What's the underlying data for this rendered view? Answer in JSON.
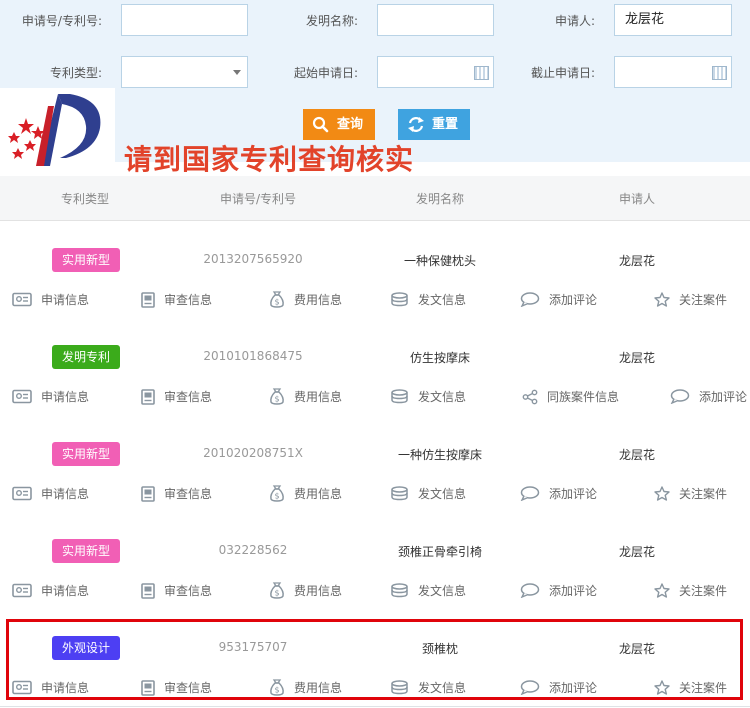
{
  "search": {
    "labels": {
      "app_no": "申请号/专利号:",
      "invention_name": "发明名称:",
      "applicant": "申请人:",
      "patent_type": "专利类型:",
      "start_date": "起始申请日:",
      "end_date": "截止申请日:"
    },
    "values": {
      "app_no": "",
      "invention_name": "",
      "applicant": "龙层花",
      "patent_type": "",
      "start_date": "",
      "end_date": ""
    },
    "buttons": {
      "query": "查询",
      "reset": "重置"
    }
  },
  "overlay_text": "请到国家专利查询核实",
  "table": {
    "headers": [
      "专利类型",
      "申请号/专利号",
      "发明名称",
      "申请人"
    ],
    "rows": [
      {
        "type": "实用新型",
        "type_color": "#f15fb5",
        "number": "2013207565920",
        "title": "一种保健枕头",
        "applicant": "龙层花",
        "actions": [
          "申请信息",
          "审查信息",
          "费用信息",
          "发文信息",
          "添加评论",
          "关注案件"
        ],
        "icons": [
          "id-card-icon",
          "document-icon",
          "money-bag-icon",
          "coins-stack-icon",
          "comment-icon",
          "star-icon"
        ]
      },
      {
        "type": "发明专利",
        "type_color": "#3bab1b",
        "number": "2010101868475",
        "title": "仿生按摩床",
        "applicant": "龙层花",
        "actions": [
          "申请信息",
          "审查信息",
          "费用信息",
          "发文信息",
          "同族案件信息",
          "添加评论"
        ],
        "icons": [
          "id-card-icon",
          "document-icon",
          "money-bag-icon",
          "coins-stack-icon",
          "share-icon",
          "comment-icon"
        ]
      },
      {
        "type": "实用新型",
        "type_color": "#f15fb5",
        "number": "201020208751X",
        "title": "一种仿生按摩床",
        "applicant": "龙层花",
        "actions": [
          "申请信息",
          "审查信息",
          "费用信息",
          "发文信息",
          "添加评论",
          "关注案件"
        ],
        "icons": [
          "id-card-icon",
          "document-icon",
          "money-bag-icon",
          "coins-stack-icon",
          "comment-icon",
          "star-icon"
        ]
      },
      {
        "type": "实用新型",
        "type_color": "#f15fb5",
        "number": "032228562",
        "title": "颈椎正骨牵引椅",
        "applicant": "龙层花",
        "actions": [
          "申请信息",
          "审查信息",
          "费用信息",
          "发文信息",
          "添加评论",
          "关注案件"
        ],
        "icons": [
          "id-card-icon",
          "document-icon",
          "money-bag-icon",
          "coins-stack-icon",
          "comment-icon",
          "star-icon"
        ]
      },
      {
        "type": "外观设计",
        "type_color": "#4d3ff3",
        "number": "953175707",
        "title": "颈椎枕",
        "applicant": "龙层花",
        "actions": [
          "申请信息",
          "审查信息",
          "费用信息",
          "发文信息",
          "添加评论",
          "关注案件"
        ],
        "icons": [
          "id-card-icon",
          "document-icon",
          "money-bag-icon",
          "coins-stack-icon",
          "comment-icon",
          "star-icon"
        ]
      }
    ]
  },
  "colors": {
    "query_button": "#f28a14",
    "reset_button": "#3fa3e0",
    "highlight": "#e0040b",
    "overlay": "#e2432a"
  }
}
